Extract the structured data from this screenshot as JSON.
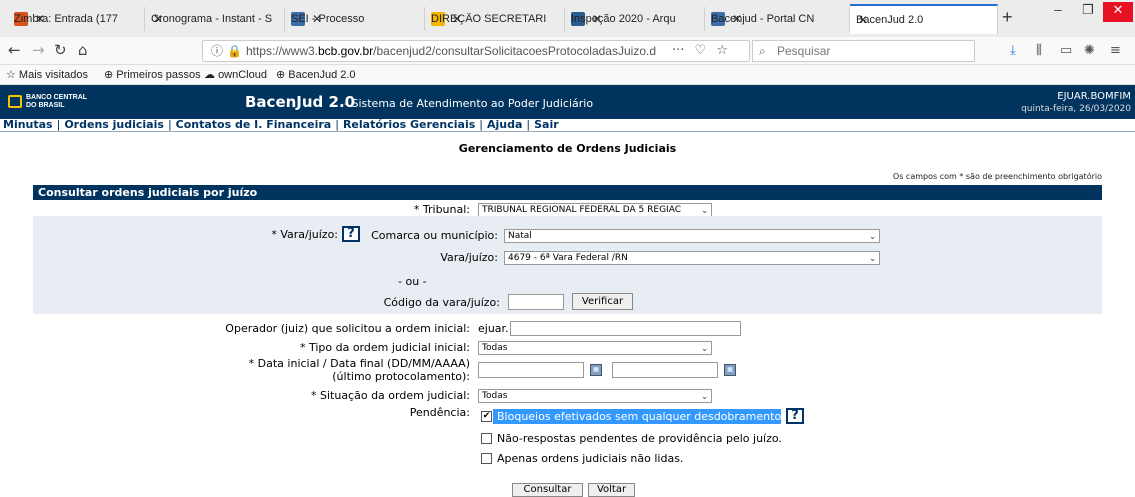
{
  "browser": {
    "tabs": [
      {
        "label": "Zimbra: Entrada (177",
        "favicon_color": "#d9531e"
      },
      {
        "label": "Cronograma - Instant - S",
        "favicon_color": "#ffffff"
      },
      {
        "label": "SEI - Processo",
        "favicon_color": "#3b6ea8"
      },
      {
        "label": "DIREÇÃO SECRETARI",
        "favicon_color": "#f4b400"
      },
      {
        "label": "Inspeção 2020 - Arqu",
        "favicon_color": "#2a5c8f"
      },
      {
        "label": "Bacenjud - Portal CN",
        "favicon_color": "#3b6ea8"
      },
      {
        "label": "BacenJud 2.0",
        "favicon_color": "#ffffff"
      }
    ],
    "url_prefix": "https://www3.",
    "url_host": "bcb.gov.br",
    "url_path": "/bacenjud2/consultarSolicitacoesProtocoladasJuizo.d",
    "url_more": "···",
    "search_placeholder": "Pesquisar",
    "bookmarks": [
      "Mais visitados",
      "Primeiros passos",
      "ownCloud",
      "BacenJud 2.0"
    ]
  },
  "header": {
    "logo_line1": "BANCO CENTRAL",
    "logo_line2": "DO BRASIL",
    "title": "BacenJud 2.0",
    "subtitle": "- Sistema de Atendimento ao Poder Judiciário",
    "user": "EJUAR.BOMFIM",
    "date": "quinta-feira, 26/03/2020",
    "brand_color": "#00335e"
  },
  "menu": [
    "Minutas",
    "Ordens judiciais",
    "Contatos de I. Financeira",
    "Relatórios Gerenciais",
    "Ajuda",
    "Sair"
  ],
  "page": {
    "title": "Gerenciamento de Ordens Judiciais",
    "required_note": "Os campos com * são de preenchimento obrigatório",
    "section_title": "Consultar ordens judiciais por juízo"
  },
  "form": {
    "tribunal_label": "* Tribunal:",
    "tribunal_value": "TRIBUNAL REGIONAL FEDERAL DA 5 REGIAC",
    "vara_label": "* Vara/juízo:",
    "comarca_label": "Comarca ou município:",
    "comarca_value": "Natal",
    "vara_juizo_label": "Vara/juízo:",
    "vara_juizo_value": "4679 - 6ª Vara Federal /RN",
    "ou": "- ou -",
    "codigo_label": "Código da vara/juízo:",
    "verificar": "Verificar",
    "operador_label": "Operador (juiz) que solicitou a ordem inicial:",
    "operador_value": "ejuar.",
    "tipo_label": "* Tipo da ordem judicial inicial:",
    "tipo_value": "Todas",
    "data_label_1": "* Data inicial / Data final (DD/MM/AAAA)",
    "data_label_2": "(último protocolamento):",
    "situacao_label": "* Situação da ordem judicial:",
    "situacao_value": "Todas",
    "pendencia_label": "Pendência:",
    "pendencias": [
      {
        "label": "Bloqueios efetivados sem qualquer desdobramento.",
        "checked": true
      },
      {
        "label": "Não-respostas pendentes de providência pelo juízo.",
        "checked": false
      },
      {
        "label": "Apenas ordens judiciais não lidas.",
        "checked": false
      }
    ],
    "consultar": "Consultar",
    "voltar": "Voltar"
  }
}
